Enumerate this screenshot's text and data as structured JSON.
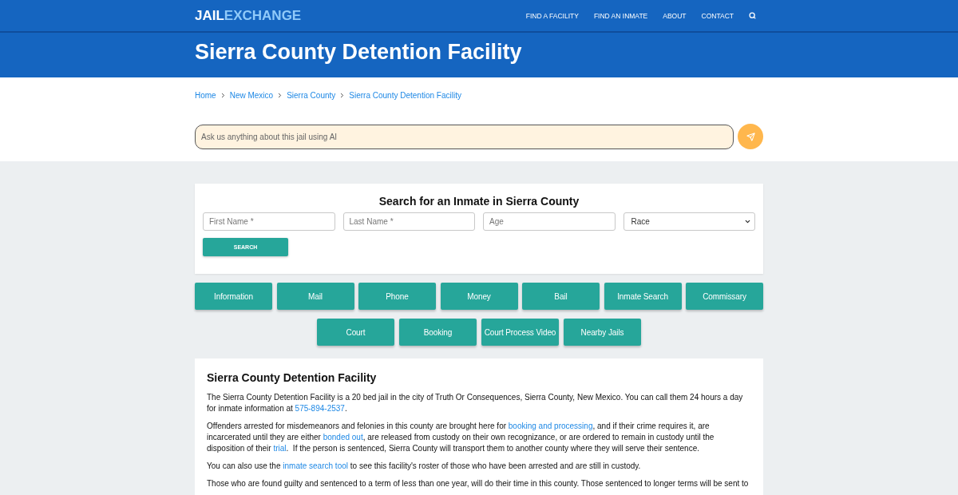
{
  "navbar": {
    "logo": {
      "part_1": "JAIL",
      "part_2": "EXCHANGE"
    },
    "links": [
      "FIND A FACILITY",
      "FIND AN INMATE",
      "ABOUT",
      "CONTACT"
    ]
  },
  "page_title": "Sierra County Detention Facility",
  "breadcrumbs": [
    "Home",
    "New Mexico",
    "Sierra County",
    "Sierra County Detention Facility"
  ],
  "ai_search": {
    "placeholder": "Ask us anything about this jail using AI"
  },
  "inmate_search": {
    "title": "Search for an Inmate in Sierra County",
    "fields": [
      {
        "kind": "input",
        "placeholder": "First Name *"
      },
      {
        "kind": "input",
        "placeholder": "Last Name *"
      },
      {
        "kind": "input",
        "placeholder": "Age"
      },
      {
        "kind": "select",
        "value": "Race"
      }
    ],
    "button": "SEARCH"
  },
  "section_buttons": [
    [
      "Information",
      "Mail",
      "Phone",
      "Money",
      "Bail",
      "Inmate Search",
      "Commissary"
    ],
    [
      "Court",
      "Booking",
      "Court Process Video",
      "Nearby Jails"
    ]
  ],
  "article": {
    "heading": "Sierra County Detention Facility",
    "paragraphs": [
      {
        "parts": [
          {
            "kind": "text",
            "text": "The Sierra County Detention Facility is a 20 bed jail in the city of Truth Or Consequences, Sierra County, New Mexico. You can call them 24 hours a day for inmate information at "
          },
          {
            "kind": "link",
            "text": "575-894-2537"
          },
          {
            "kind": "text",
            "text": "."
          }
        ]
      },
      {
        "parts": [
          {
            "kind": "text",
            "text": "Offenders arrested for misdemeanors and felonies in this county are brought here for "
          },
          {
            "kind": "link",
            "text": "booking and processing"
          },
          {
            "kind": "text",
            "text": ", and if their crime requires it, are incarcerated until they are either "
          },
          {
            "kind": "link",
            "text": "bonded out"
          },
          {
            "kind": "text",
            "text": ", are released from custody on their own recognizance, or are ordered to remain in custody until the disposition of their "
          },
          {
            "kind": "link",
            "text": "trial"
          },
          {
            "kind": "text",
            "text": ".  If the person is sentenced, Sierra County will transport them to another county where they will serve their sentence."
          }
        ]
      },
      {
        "parts": [
          {
            "kind": "text",
            "text": "You can also use the "
          },
          {
            "kind": "link",
            "text": "inmate search tool"
          },
          {
            "kind": "text",
            "text": " to see this facility's roster of those who have been arrested and are still in custody."
          }
        ]
      },
      {
        "parts": [
          {
            "kind": "text",
            "text": "Those who are found guilty and sentenced to a term of less than one year, will do their time in this county. Those sentenced to longer terms will be sent to"
          }
        ]
      }
    ]
  }
}
